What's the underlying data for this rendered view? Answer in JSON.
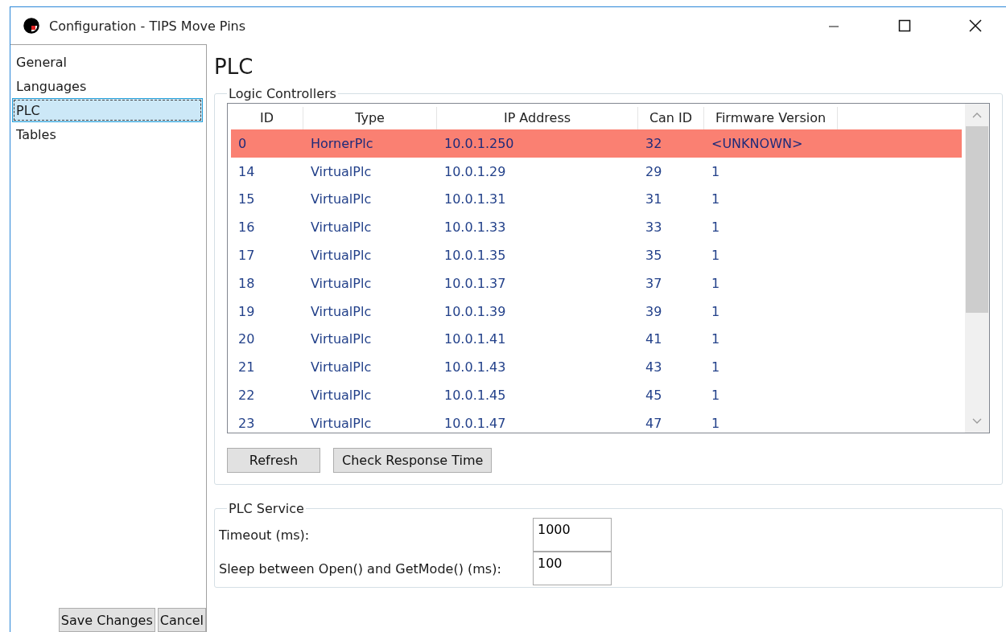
{
  "window": {
    "title": "Configuration - TIPS Move Pins"
  },
  "sidebar": {
    "items": [
      {
        "label": "General",
        "selected": false
      },
      {
        "label": "Languages",
        "selected": false
      },
      {
        "label": "PLC",
        "selected": true
      },
      {
        "label": "Tables",
        "selected": false
      }
    ],
    "buttons": [
      "Save Changes",
      "Cancel"
    ]
  },
  "page": {
    "title": "PLC"
  },
  "logic_controllers": {
    "title": "Logic Controllers",
    "table": {
      "columns": [
        "ID",
        "Type",
        "IP Address",
        "Can ID",
        "Firmware Version"
      ],
      "rows": [
        {
          "cells": [
            "0",
            "HornerPlc",
            "10.0.1.250",
            "32",
            "<UNKNOWN>"
          ],
          "selected": true
        },
        {
          "cells": [
            "14",
            "VirtualPlc",
            "10.0.1.29",
            "29",
            "1"
          ],
          "selected": false
        },
        {
          "cells": [
            "15",
            "VirtualPlc",
            "10.0.1.31",
            "31",
            "1"
          ],
          "selected": false
        },
        {
          "cells": [
            "16",
            "VirtualPlc",
            "10.0.1.33",
            "33",
            "1"
          ],
          "selected": false
        },
        {
          "cells": [
            "17",
            "VirtualPlc",
            "10.0.1.35",
            "35",
            "1"
          ],
          "selected": false
        },
        {
          "cells": [
            "18",
            "VirtualPlc",
            "10.0.1.37",
            "37",
            "1"
          ],
          "selected": false
        },
        {
          "cells": [
            "19",
            "VirtualPlc",
            "10.0.1.39",
            "39",
            "1"
          ],
          "selected": false
        },
        {
          "cells": [
            "20",
            "VirtualPlc",
            "10.0.1.41",
            "41",
            "1"
          ],
          "selected": false
        },
        {
          "cells": [
            "21",
            "VirtualPlc",
            "10.0.1.43",
            "43",
            "1"
          ],
          "selected": false
        },
        {
          "cells": [
            "22",
            "VirtualPlc",
            "10.0.1.45",
            "45",
            "1"
          ],
          "selected": false
        },
        {
          "cells": [
            "23",
            "VirtualPlc",
            "10.0.1.47",
            "47",
            "1"
          ],
          "selected": false
        }
      ]
    },
    "buttons": [
      "Refresh",
      "Check Response Time"
    ]
  },
  "plc_service": {
    "title": "PLC Service",
    "fields": [
      {
        "label": "Timeout (ms):",
        "value": "1000"
      },
      {
        "label": "Sleep between Open() and GetMode() (ms):",
        "value": "100"
      }
    ]
  }
}
